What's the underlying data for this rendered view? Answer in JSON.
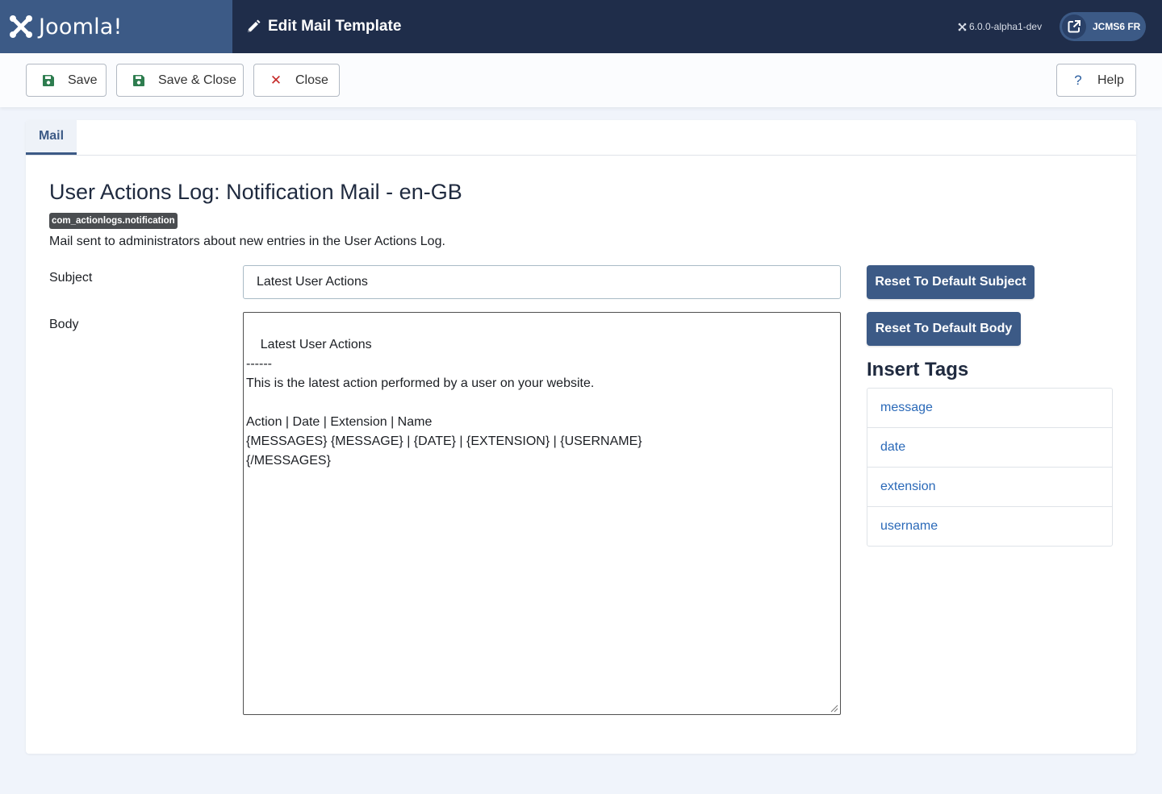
{
  "header": {
    "brand": "Joomla!",
    "page_title": "Edit Mail Template",
    "version": "6.0.0-alpha1-dev",
    "user_label": "JCMS6 FR"
  },
  "toolbar": {
    "save_label": "Save",
    "save_close_label": "Save & Close",
    "close_label": "Close",
    "help_label": "Help"
  },
  "tabs": [
    {
      "label": "Mail",
      "active": true
    }
  ],
  "template": {
    "title": "User Actions Log: Notification Mail - en-GB",
    "key": "com_actionlogs.notification",
    "description": "Mail sent to administrators about new entries in the User Actions Log."
  },
  "form": {
    "subject_label": "Subject",
    "subject_value": "Latest User Actions",
    "body_label": "Body",
    "body_value": "Latest User Actions\n------\nThis is the latest action performed by a user on your website.\n\nAction | Date | Extension | Name\n{MESSAGES} {MESSAGE} | {DATE} | {EXTENSION} | {USERNAME}\n{/MESSAGES}"
  },
  "actions": {
    "reset_subject_label": "Reset To Default Subject",
    "reset_body_label": "Reset To Default Body"
  },
  "insert_tags": {
    "title": "Insert Tags",
    "items": [
      "message",
      "date",
      "extension",
      "username"
    ]
  },
  "colors": {
    "header_bg": "#1f2d4a",
    "logo_bg": "#3c5a86",
    "primary": "#3c5a86",
    "link": "#2a69b8",
    "close_icon": "#c52827",
    "save_icon": "#2e7d4f"
  }
}
